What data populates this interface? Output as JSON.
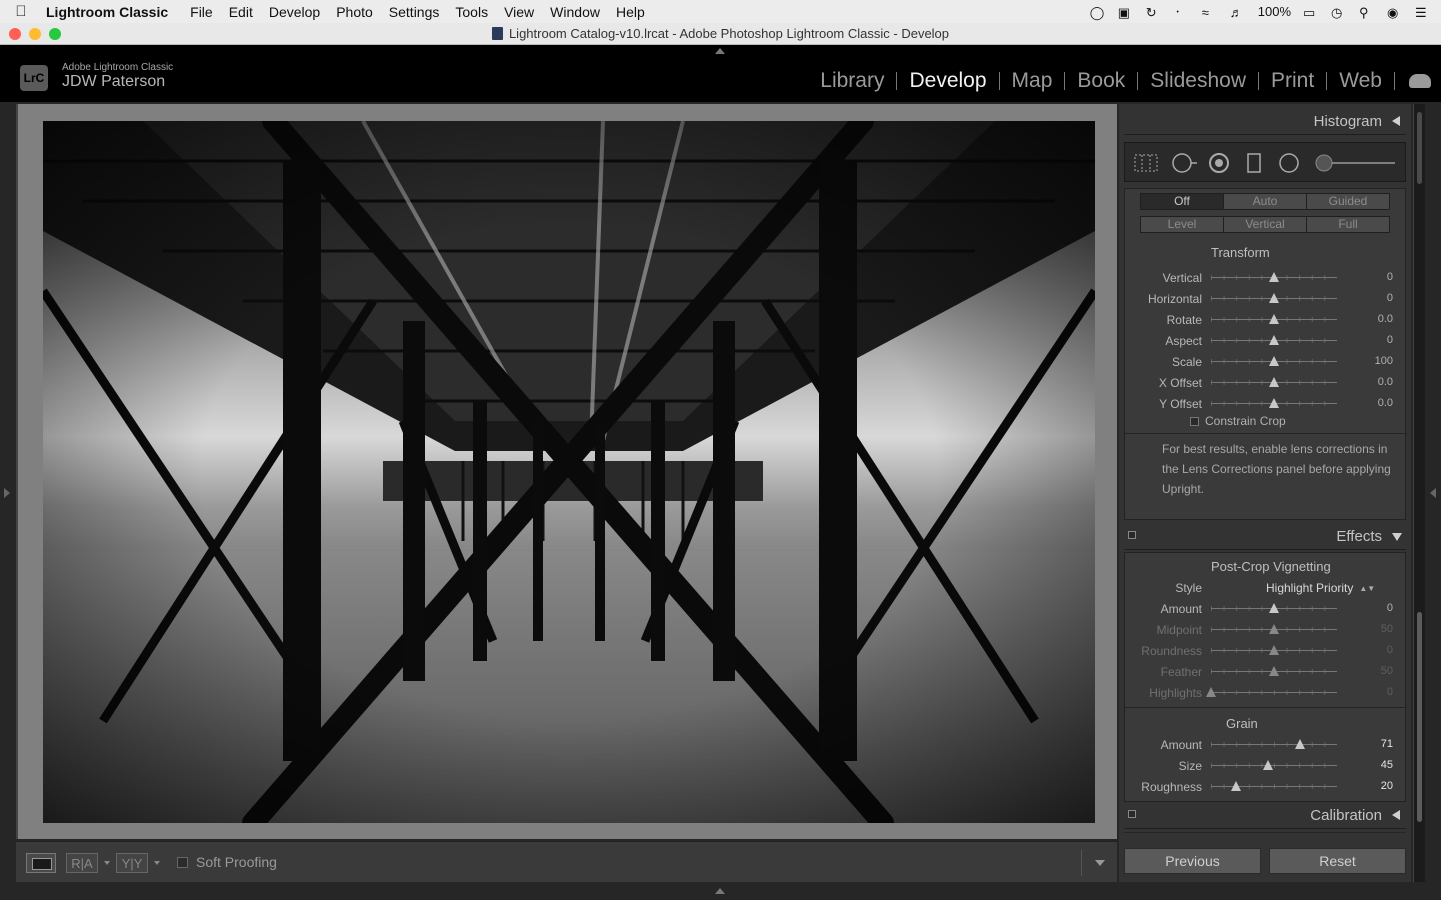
{
  "menubar": {
    "app_name": "Lightroom Classic",
    "items": [
      "File",
      "Edit",
      "Develop",
      "Photo",
      "Settings",
      "Tools",
      "View",
      "Window",
      "Help"
    ],
    "battery": "100%"
  },
  "window": {
    "title": "Lightroom Catalog-v10.lrcat - Adobe Photoshop Lightroom Classic - Develop"
  },
  "identity": {
    "badge": "LrC",
    "product": "Adobe Lightroom Classic",
    "user": "JDW Paterson"
  },
  "modules": [
    "Library",
    "Develop",
    "Map",
    "Book",
    "Slideshow",
    "Print",
    "Web"
  ],
  "active_module": "Develop",
  "toolbar": {
    "ra_label": "R|A",
    "yy_label": "Y|Y",
    "soft_proofing": "Soft Proofing"
  },
  "panels": {
    "histogram": "Histogram",
    "effects": "Effects",
    "calibration": "Calibration"
  },
  "upright": {
    "row1": [
      "Off",
      "Auto",
      "Guided"
    ],
    "row2": [
      "Level",
      "Vertical",
      "Full"
    ],
    "selected": "Off"
  },
  "transform": {
    "title": "Transform",
    "sliders": [
      {
        "label": "Vertical",
        "value": "0",
        "position": 0.5
      },
      {
        "label": "Horizontal",
        "value": "0",
        "position": 0.5
      },
      {
        "label": "Rotate",
        "value": "0.0",
        "position": 0.5
      },
      {
        "label": "Aspect",
        "value": "0",
        "position": 0.5
      },
      {
        "label": "Scale",
        "value": "100",
        "position": 0.5
      },
      {
        "label": "X Offset",
        "value": "0.0",
        "position": 0.5
      },
      {
        "label": "Y Offset",
        "value": "0.0",
        "position": 0.5
      }
    ],
    "constrain_crop": "Constrain Crop",
    "note": "For best results, enable lens corrections in the Lens Corrections panel before applying Upright."
  },
  "vignetting": {
    "title": "Post-Crop Vignetting",
    "style_label": "Style",
    "style_value": "Highlight Priority",
    "sliders": [
      {
        "label": "Amount",
        "value": "0",
        "position": 0.5,
        "dim": false
      },
      {
        "label": "Midpoint",
        "value": "50",
        "position": 0.5,
        "dim": true
      },
      {
        "label": "Roundness",
        "value": "0",
        "position": 0.5,
        "dim": true
      },
      {
        "label": "Feather",
        "value": "50",
        "position": 0.5,
        "dim": true
      },
      {
        "label": "Highlights",
        "value": "0",
        "position": 0.0,
        "dim": true
      }
    ]
  },
  "grain": {
    "title": "Grain",
    "sliders": [
      {
        "label": "Amount",
        "value": "71",
        "position": 0.71
      },
      {
        "label": "Size",
        "value": "45",
        "position": 0.45
      },
      {
        "label": "Roughness",
        "value": "20",
        "position": 0.2
      }
    ]
  },
  "buttons": {
    "previous": "Previous",
    "reset": "Reset"
  },
  "icons": {
    "apple": "apple-icon",
    "cloud": "cloud-icon",
    "wifi": "wifi-icon",
    "bluetooth": "bluetooth-icon",
    "search": "search-icon"
  }
}
